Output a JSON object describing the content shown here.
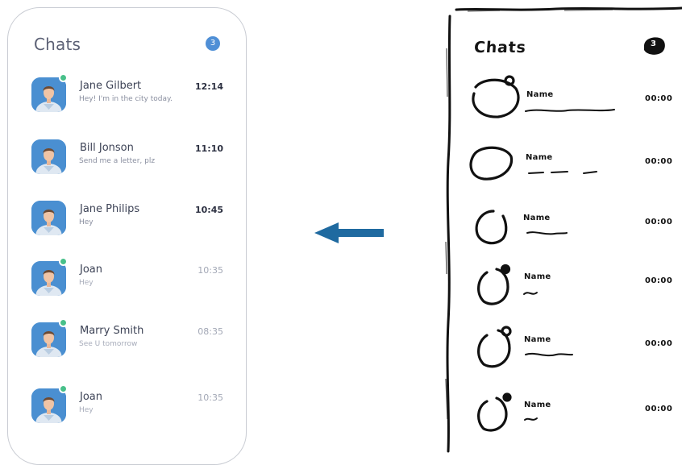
{
  "chat_list": {
    "title": "Chats",
    "unread_badge": "3",
    "items": [
      {
        "name": "Jane Gilbert",
        "message": "Hey! I'm in the city today.",
        "time": "12:14",
        "online": true,
        "unread": true
      },
      {
        "name": "Bill Jonson",
        "message": "Send me a letter, plz",
        "time": "11:10",
        "online": false,
        "unread": true
      },
      {
        "name": "Jane Philips",
        "message": "Hey",
        "time": "10:45",
        "online": false,
        "unread": true
      },
      {
        "name": "Joan",
        "message": "Hey",
        "time": "10:35",
        "online": true,
        "unread": false
      },
      {
        "name": "Marry Smith",
        "message": "See U tomorrow",
        "time": "08:35",
        "online": true,
        "unread": false
      },
      {
        "name": "Joan",
        "message": "Hey",
        "time": "10:35",
        "online": true,
        "unread": false
      }
    ]
  },
  "arrow": {
    "icon": "arrow-left-icon",
    "color": "#1f6aa0"
  },
  "sketch": {
    "title": "Chats",
    "badge": "3",
    "items": [
      {
        "label": "Name",
        "time": "00:00"
      },
      {
        "label": "Name",
        "time": "00:00"
      },
      {
        "label": "Name",
        "time": "00:00"
      },
      {
        "label": "Name",
        "time": "00:00"
      },
      {
        "label": "Name",
        "time": "00:00"
      },
      {
        "label": "Name",
        "time": "00:00"
      }
    ]
  },
  "colors": {
    "accent": "#4f8fd6",
    "online": "#48c08a",
    "avatar_bg": "#4a8fd1",
    "ink": "#151515"
  }
}
